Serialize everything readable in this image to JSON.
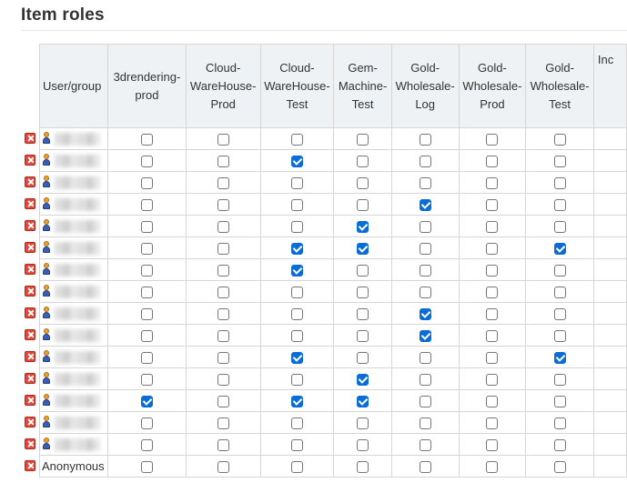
{
  "title": "Item roles",
  "columns": {
    "user_group": "User/group",
    "roles": [
      [
        "3drendering-",
        "prod"
      ],
      [
        "Cloud-",
        "WareHouse-",
        "Prod"
      ],
      [
        "Cloud-",
        "WareHouse-",
        "Test"
      ],
      [
        "Gem-",
        "Machine-",
        "Test"
      ],
      [
        "Gold-",
        "Wholesale-",
        "Log"
      ],
      [
        "Gold-",
        "Wholesale-",
        "Prod"
      ],
      [
        "Gold-",
        "Wholesale-",
        "Test"
      ],
      [
        "Inc"
      ]
    ]
  },
  "rows": [
    {
      "user": "",
      "type": "user",
      "checks": [
        false,
        false,
        false,
        false,
        false,
        false,
        false
      ]
    },
    {
      "user": "",
      "type": "user",
      "checks": [
        false,
        false,
        true,
        false,
        false,
        false,
        false
      ]
    },
    {
      "user": "",
      "type": "user",
      "checks": [
        false,
        false,
        false,
        false,
        false,
        false,
        false
      ]
    },
    {
      "user": "",
      "type": "user",
      "checks": [
        false,
        false,
        false,
        false,
        true,
        false,
        false
      ]
    },
    {
      "user": "",
      "type": "user",
      "checks": [
        false,
        false,
        false,
        true,
        false,
        false,
        false
      ]
    },
    {
      "user": "",
      "type": "user",
      "checks": [
        false,
        false,
        true,
        true,
        false,
        false,
        true
      ]
    },
    {
      "user": "",
      "type": "user",
      "checks": [
        false,
        false,
        true,
        false,
        false,
        false,
        false
      ]
    },
    {
      "user": "",
      "type": "user",
      "checks": [
        false,
        false,
        false,
        false,
        false,
        false,
        false
      ]
    },
    {
      "user": "",
      "type": "user",
      "checks": [
        false,
        false,
        false,
        false,
        true,
        false,
        false
      ]
    },
    {
      "user": "",
      "type": "user",
      "checks": [
        false,
        false,
        false,
        false,
        true,
        false,
        false
      ]
    },
    {
      "user": "",
      "type": "user",
      "checks": [
        false,
        false,
        true,
        false,
        false,
        false,
        true
      ]
    },
    {
      "user": "",
      "type": "user",
      "checks": [
        false,
        false,
        false,
        true,
        false,
        false,
        false
      ]
    },
    {
      "user": "",
      "type": "user",
      "checks": [
        true,
        false,
        true,
        true,
        false,
        false,
        false
      ]
    },
    {
      "user": "",
      "type": "user",
      "checks": [
        false,
        false,
        false,
        false,
        false,
        false,
        false
      ]
    },
    {
      "user": "",
      "type": "user",
      "checks": [
        false,
        false,
        false,
        false,
        false,
        false,
        false
      ]
    },
    {
      "user": "Anonymous",
      "type": "anonymous",
      "checks": [
        false,
        false,
        false,
        false,
        false,
        false,
        false
      ]
    }
  ],
  "colors": {
    "header_bg": "#eef2f5",
    "checkbox_checked": "#0a6cd6",
    "delete_icon": "#e2463a"
  },
  "icons": {
    "delete": "delete-icon",
    "user": "user-icon"
  }
}
